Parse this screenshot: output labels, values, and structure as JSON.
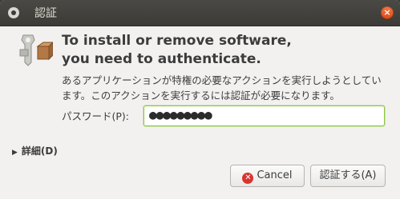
{
  "window": {
    "title": "認証",
    "close_glyph": "×"
  },
  "dialog": {
    "heading_line1": "To install or remove software,",
    "heading_line2": "you need to authenticate.",
    "description": "あるアプリケーションが特権の必要なアクションを実行しようとしています。このアクションを実行するには認証が必要になります。",
    "password_label": "パスワード(P):",
    "password_value": "●●●●●●●●●",
    "details_label": "詳細(D)",
    "details_arrow": "▶",
    "cancel_label": "Cancel",
    "cancel_icon_glyph": "✕",
    "authenticate_label": "認証する(A)"
  },
  "icons": {
    "window": "window-app-icon",
    "close": "close-icon",
    "auth": "keys-package-icon",
    "cancel": "cancel-icon",
    "expander": "expander-arrow-icon"
  },
  "colors": {
    "titlebar": "#3c3b37",
    "close_button": "#df4a16",
    "focus_border": "#8dc63f",
    "cancel_icon": "#d9332e"
  }
}
